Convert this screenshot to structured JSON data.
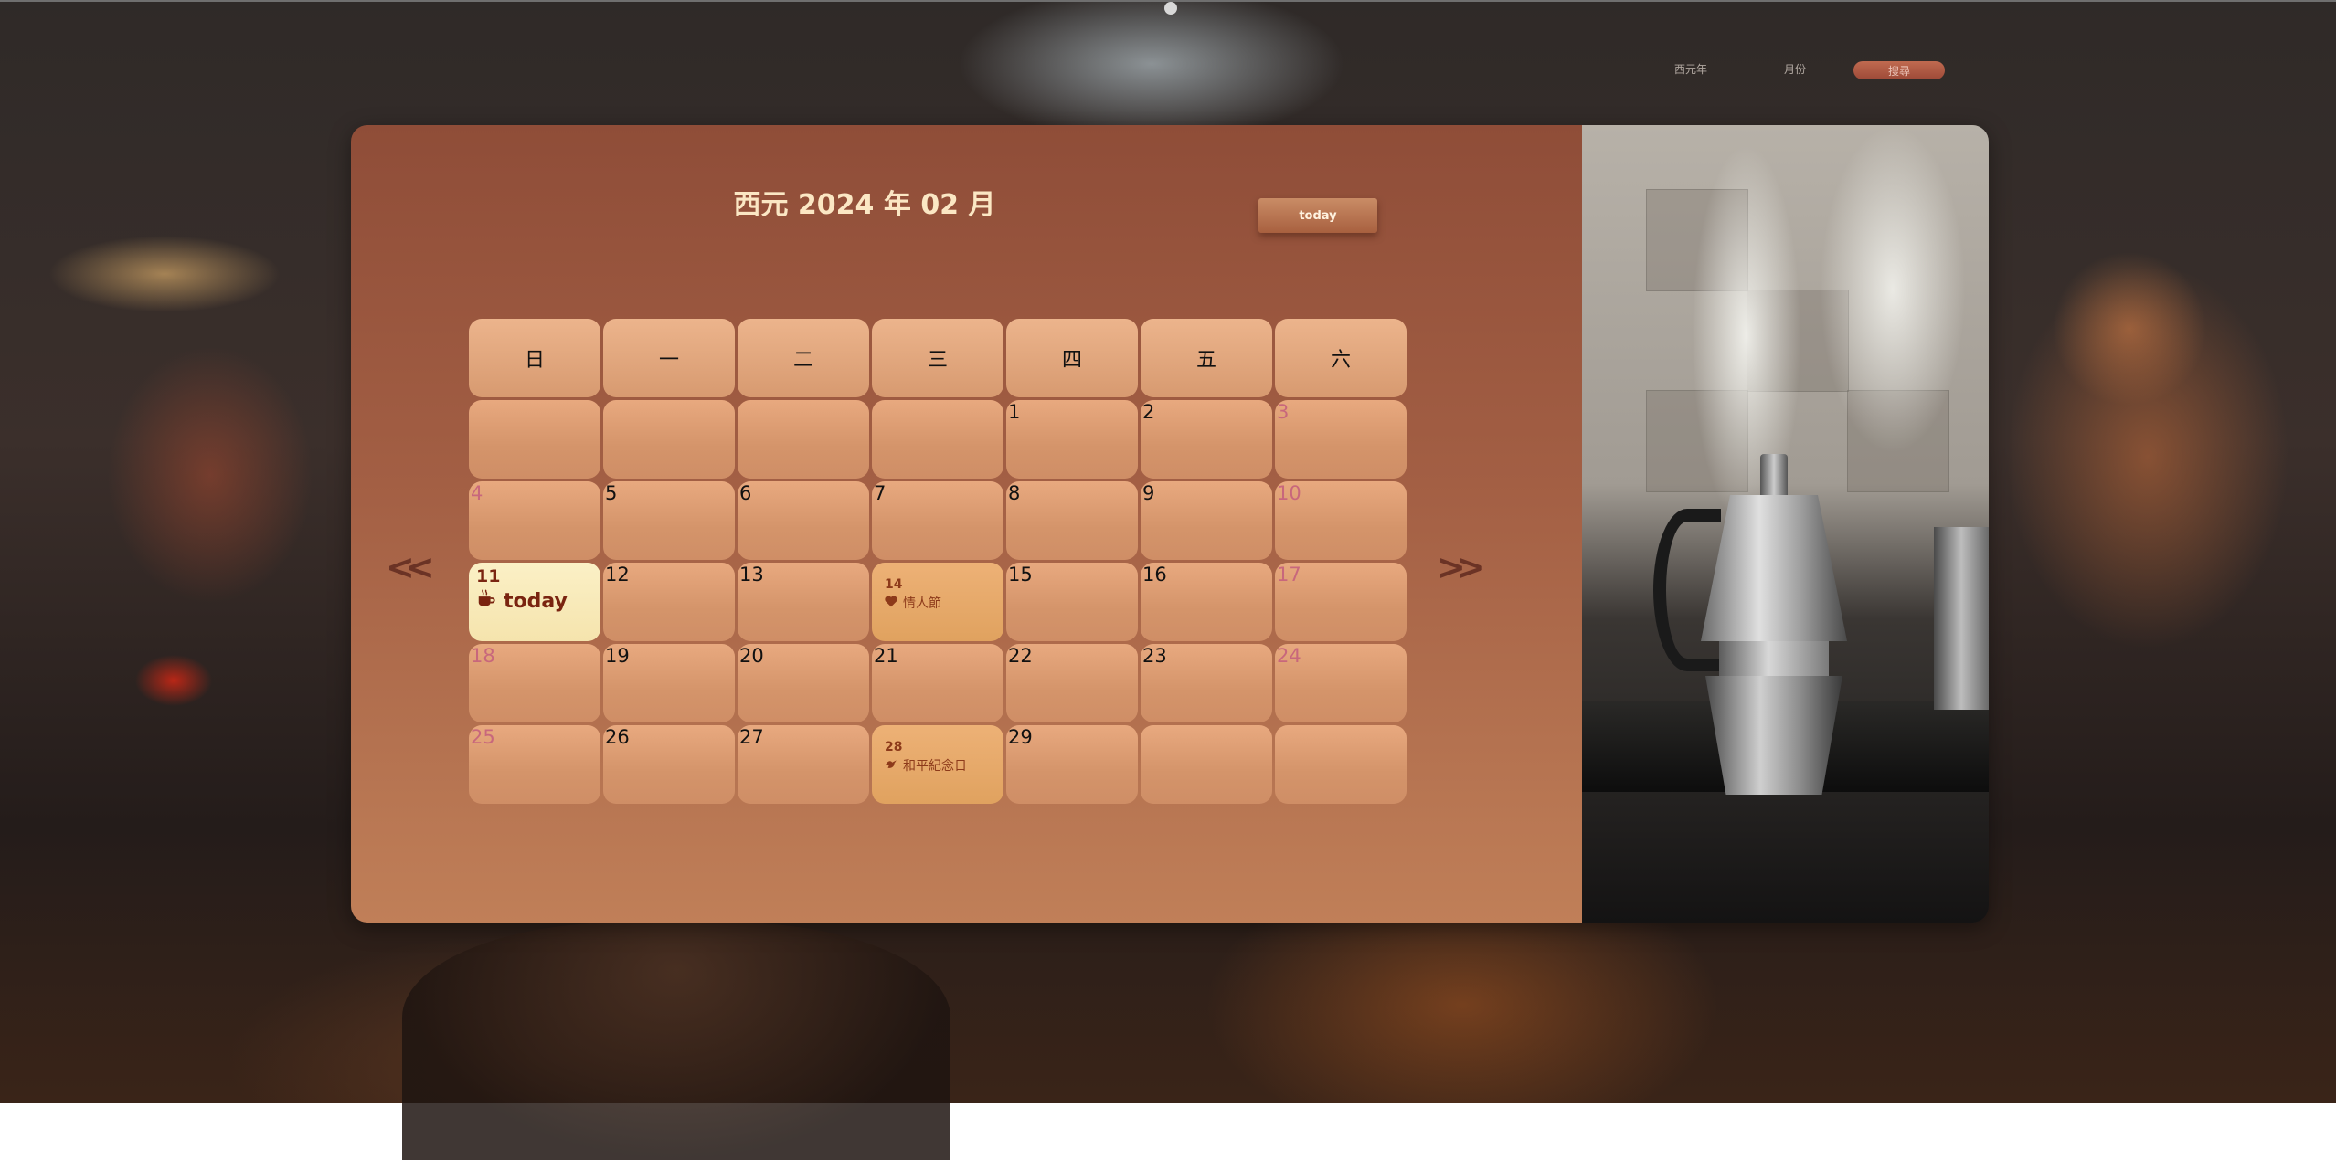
{
  "search": {
    "year_placeholder": "西元年",
    "month_placeholder": "月份",
    "submit_label": "搜尋"
  },
  "calendar": {
    "title": "西元 2024 年 02 月",
    "today_button": "today",
    "prev_arrow": "<<",
    "next_arrow": ">>",
    "weekdays": [
      "日",
      "一",
      "二",
      "三",
      "四",
      "五",
      "六"
    ],
    "weeks": [
      [
        "",
        "",
        "",
        "",
        "1",
        "2",
        "3"
      ],
      [
        "4",
        "5",
        "6",
        "7",
        "8",
        "9",
        "10"
      ],
      [
        "11",
        "12",
        "13",
        "14",
        "15",
        "16",
        "17"
      ],
      [
        "18",
        "19",
        "20",
        "21",
        "22",
        "23",
        "24"
      ],
      [
        "25",
        "26",
        "27",
        "28",
        "29",
        "",
        ""
      ]
    ],
    "today": {
      "day": "11",
      "label": "today",
      "icon": "coffee-icon"
    },
    "holidays": [
      {
        "day": "14",
        "label": "情人節",
        "icon": "heart-icon"
      },
      {
        "day": "28",
        "label": "和平紀念日",
        "icon": "dove-icon"
      }
    ]
  },
  "colors": {
    "panel_top": "#8f4d38",
    "cell": "#e8a97f",
    "holiday_cell": "#edb176",
    "today_cell": "#fbf0c6",
    "weekend_text": "#c8677c",
    "accent_text": "#7a2410"
  }
}
